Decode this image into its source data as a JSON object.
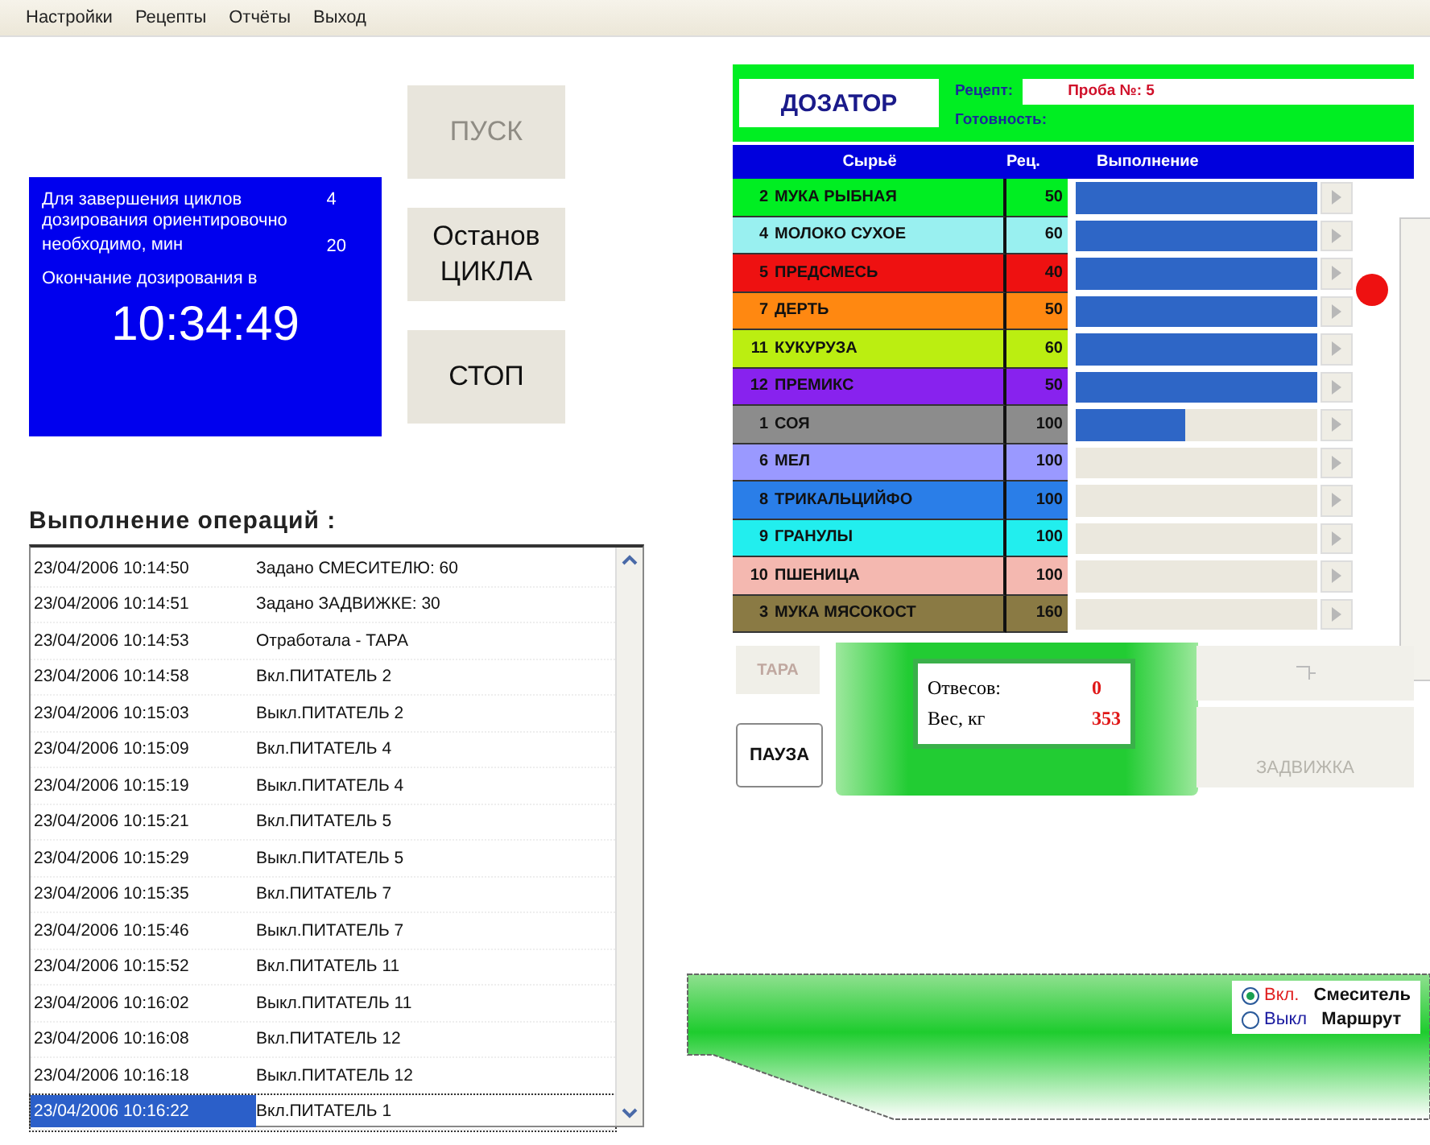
{
  "menu": [
    "Настройки",
    "Рецепты",
    "Отчёты",
    "Выход"
  ],
  "buttons": [
    {
      "label": "ПУСК",
      "disabled": true
    },
    {
      "label": "Останов ЦИКЛА",
      "disabled": false
    },
    {
      "label": "СТОП",
      "disabled": false
    }
  ],
  "info_panel": {
    "line_1": "Для завершения циклов дозирования ориентировочно",
    "cycles": "4",
    "line_2": "необходимо, мин",
    "minutes": "20",
    "end_label": "Окончание дозирования в",
    "end_time": "10:34:49"
  },
  "log": {
    "title": "Выполнение операций :",
    "rows": [
      {
        "time": "23/04/2006 10:14:50",
        "event": "Задано СМЕСИТЕЛЮ: 60",
        "selected": false
      },
      {
        "time": "23/04/2006 10:14:51",
        "event": "Задано ЗАДВИЖКЕ: 30",
        "selected": false
      },
      {
        "time": "23/04/2006 10:14:53",
        "event": "Отработала - ТАРА",
        "selected": false
      },
      {
        "time": "23/04/2006 10:14:58",
        "event": "Вкл.ПИТАТЕЛЬ 2",
        "selected": false
      },
      {
        "time": "23/04/2006 10:15:03",
        "event": "Выкл.ПИТАТЕЛЬ 2",
        "selected": false
      },
      {
        "time": "23/04/2006 10:15:09",
        "event": "Вкл.ПИТАТЕЛЬ 4",
        "selected": false
      },
      {
        "time": "23/04/2006 10:15:19",
        "event": "Выкл.ПИТАТЕЛЬ 4",
        "selected": false
      },
      {
        "time": "23/04/2006 10:15:21",
        "event": "Вкл.ПИТАТЕЛЬ 5",
        "selected": false
      },
      {
        "time": "23/04/2006 10:15:29",
        "event": "Выкл.ПИТАТЕЛЬ 5",
        "selected": false
      },
      {
        "time": "23/04/2006 10:15:35",
        "event": "Вкл.ПИТАТЕЛЬ 7",
        "selected": false
      },
      {
        "time": "23/04/2006 10:15:46",
        "event": "Выкл.ПИТАТЕЛЬ 7",
        "selected": false
      },
      {
        "time": "23/04/2006 10:15:52",
        "event": "Вкл.ПИТАТЕЛЬ 11",
        "selected": false
      },
      {
        "time": "23/04/2006 10:16:02",
        "event": "Выкл.ПИТАТЕЛЬ 11",
        "selected": false
      },
      {
        "time": "23/04/2006 10:16:08",
        "event": "Вкл.ПИТАТЕЛЬ 12",
        "selected": false
      },
      {
        "time": "23/04/2006 10:16:18",
        "event": "Выкл.ПИТАТЕЛЬ 12",
        "selected": false
      },
      {
        "time": "23/04/2006 10:16:22",
        "event": "Вкл.ПИТАТЕЛЬ 1",
        "selected": true
      }
    ]
  },
  "dispenser": {
    "title": "ДОЗАТОР",
    "recipe_label": "Рецепт:",
    "recipe_value": "Проба №: 5",
    "readiness_label": "Готовность:",
    "columns": [
      "Сырьё",
      "Рец.",
      "Выполнение"
    ],
    "rows": [
      {
        "number": "2",
        "name": "МУКА РЫБНАЯ",
        "recipe": "50",
        "color": "#00ee22",
        "level": 1
      },
      {
        "number": "4",
        "name": "МОЛОКО СУХОЕ",
        "recipe": "60",
        "color": "#99f0f0",
        "level": 1
      },
      {
        "number": "5",
        "name": "ПРЕДСМЕСЬ",
        "recipe": "40",
        "color": "#ee1111",
        "level": 1
      },
      {
        "number": "7",
        "name": "ДЕРТЬ",
        "recipe": "50",
        "color": "#ff8811",
        "level": 1
      },
      {
        "number": "11",
        "name": "КУКУРУЗА",
        "recipe": "60",
        "color": "#bbee11",
        "level": 1
      },
      {
        "number": "12",
        "name": "ПРЕМИКС",
        "recipe": "50",
        "color": "#8822ee",
        "level": 1
      },
      {
        "number": "1",
        "name": "СОЯ",
        "recipe": "100",
        "color": "#8c8c8c",
        "level": 0.45
      },
      {
        "number": "6",
        "name": "МЕЛ",
        "recipe": "100",
        "color": "#9a99ff",
        "level": 0
      },
      {
        "number": "8",
        "name": "ТРИКАЛЬЦИЙФО",
        "recipe": "100",
        "color": "#2a7ee8",
        "level": 0
      },
      {
        "number": "9",
        "name": "ГРАНУЛЫ",
        "recipe": "100",
        "color": "#22eeee",
        "level": 0
      },
      {
        "number": "10",
        "name": "ПШЕНИЦА",
        "recipe": "100",
        "color": "#f4b8b0",
        "level": 0
      },
      {
        "number": "3",
        "name": "МУКА МЯСОКОСТ",
        "recipe": "160",
        "color": "#8a7a44",
        "level": 0
      }
    ]
  },
  "tare_button": {
    "label": "ТАРА",
    "disabled": true
  },
  "pause_button": {
    "label": "ПАУЗА",
    "disabled": false
  },
  "weighing": {
    "portions_label": "Отвесов:",
    "portions": "0",
    "weight_label": "Вес, кг",
    "weight": "353"
  },
  "gate_button": {
    "label": "ЗАДВИЖКА",
    "disabled": true
  },
  "mixer": {
    "options": [
      {
        "label": "Вкл.",
        "caption": "Смеситель",
        "selected": true
      },
      {
        "label": "Выкл",
        "caption": "Маршрут",
        "selected": false
      }
    ]
  }
}
